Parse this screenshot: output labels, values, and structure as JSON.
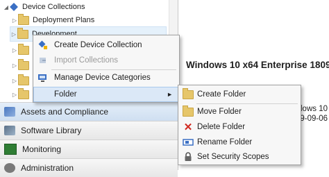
{
  "tree": {
    "device_collections": "Device Collections",
    "deployment_plans": "Deployment Plans",
    "development": "Development"
  },
  "wunderbar": {
    "assets": "Assets and Compliance",
    "software": "Software Library",
    "monitoring": "Monitoring",
    "administration": "Administration"
  },
  "details": {
    "title": "Windows 10 x64 Enterprise 1809",
    "fragment_1": "ndows 10",
    "fragment_2": "19-09-06"
  },
  "context_menu": {
    "create_device_collection": "Create Device Collection",
    "import_collections": "Import Collections",
    "manage_device_categories": "Manage Device Categories",
    "folder": "Folder"
  },
  "folder_submenu": {
    "create_folder": "Create Folder",
    "move_folder": "Move Folder",
    "delete_folder": "Delete Folder",
    "rename_folder": "Rename Folder",
    "set_security_scopes": "Set Security Scopes"
  },
  "colors": {
    "hover_bg": "#dbe8f7",
    "selected_bg": "#e5f1fb",
    "folder_yellow": "#e6c66a"
  }
}
